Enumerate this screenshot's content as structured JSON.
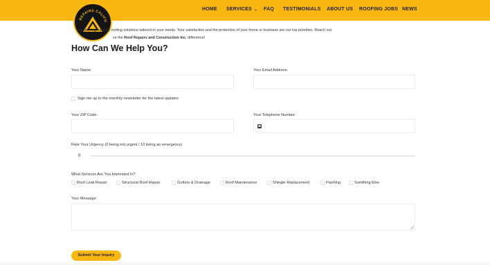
{
  "nav": {
    "home": "HOME",
    "services": "SERVICES",
    "faq": "FAQ",
    "testimonials": "TESTIMONIALS",
    "about": "ABOUT US",
    "jobs": "ROOFING JOBS",
    "news": "NEWS"
  },
  "logo": {
    "text": "REPAIRS CALIFO"
  },
  "intro": {
    "line1": "reliable, high-quality roofing solutions tailored to your needs. Your satisfaction and the protection of your home or business are our top priorities. Reach out",
    "line2_pre": "ce the",
    "line2_company": "Roof Repairs and Construction Inc.",
    "line2_post": "difference!"
  },
  "form": {
    "title": "How Can We Help You?",
    "name_label": "Your Name:",
    "email_label": "Your Email Address:",
    "newsletter_label": "Sign me up to the monthly newsletter for the latest updates",
    "zip_label": "Your ZIP Code:",
    "phone_label": "Your Telephone Number:",
    "urgency_label": "Rate Your Urgency (0 being not urgent / 10 being an emergency)",
    "urgency_value": "0",
    "services_label": "What Services Are You Interested In?",
    "services": [
      "Roof Leak Repair",
      "Structural Roof Repair",
      "Gutters & Drainage",
      "Roof Maintenance",
      "Shingle Replacement",
      "Flashing",
      "Somthing Else"
    ],
    "message_label": "Your Message:",
    "submit_label": "Submit Your Inquiry"
  },
  "colors": {
    "accent": "#fbb711",
    "text": "#222222",
    "border": "#ededed"
  },
  "icons": {
    "services_dropdown": "chevron-down-icon",
    "phone": "phone-icon",
    "resize": "resize-handle-icon"
  }
}
